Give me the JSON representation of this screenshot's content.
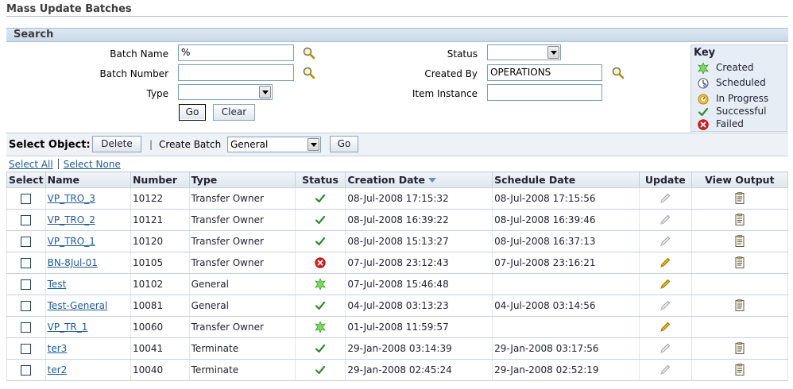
{
  "page": {
    "title": "Mass Update Batches"
  },
  "search": {
    "header": "Search",
    "batch_name_label": "Batch Name",
    "batch_name_value": "%",
    "batch_number_label": "Batch Number",
    "batch_number_value": "",
    "type_label": "Type",
    "type_value": "",
    "status_label": "Status",
    "status_value": "",
    "created_by_label": "Created By",
    "created_by_value": "OPERATIONS",
    "item_instance_label": "Item Instance",
    "item_instance_value": "",
    "go_label": "Go",
    "clear_label": "Clear"
  },
  "key": {
    "title": "Key",
    "items": [
      {
        "icon": "created-icon",
        "label": "Created"
      },
      {
        "icon": "scheduled-icon",
        "label": "Scheduled"
      },
      {
        "icon": "in-progress-icon",
        "label": "In Progress"
      },
      {
        "icon": "successful-icon",
        "label": "Successful"
      },
      {
        "icon": "failed-icon",
        "label": "Failed"
      }
    ]
  },
  "toolbar": {
    "select_object_label": "Select Object:",
    "delete_label": "Delete",
    "pipe": "|",
    "create_batch_label": "Create Batch",
    "create_batch_value": "General",
    "go_label": "Go"
  },
  "selection": {
    "select_all": "Select All",
    "select_none": "Select None"
  },
  "table": {
    "headers": {
      "select": "Select",
      "name": "Name",
      "number": "Number",
      "type": "Type",
      "status": "Status",
      "creation_date": "Creation Date",
      "schedule_date": "Schedule Date",
      "update": "Update",
      "view_output": "View Output"
    },
    "rows": [
      {
        "name": "VP_TRO_3",
        "number": "10122",
        "type": "Transfer Owner",
        "status": "successful",
        "creation_date": "08-Jul-2008 17:15:32",
        "schedule_date": "08-Jul-2008 17:15:56",
        "update": "disabled",
        "view_output": true
      },
      {
        "name": "VP_TRO_2",
        "number": "10121",
        "type": "Transfer Owner",
        "status": "successful",
        "creation_date": "08-Jul-2008 16:39:22",
        "schedule_date": "08-Jul-2008 16:39:46",
        "update": "disabled",
        "view_output": true
      },
      {
        "name": "VP_TRO_1",
        "number": "10120",
        "type": "Transfer Owner",
        "status": "successful",
        "creation_date": "08-Jul-2008 15:13:27",
        "schedule_date": "08-Jul-2008 16:37:13",
        "update": "disabled",
        "view_output": true
      },
      {
        "name": "BN-8Jul-01",
        "number": "10105",
        "type": "Transfer Owner",
        "status": "failed",
        "creation_date": "07-Jul-2008 23:12:43",
        "schedule_date": "07-Jul-2008 23:16:21",
        "update": "enabled",
        "view_output": true
      },
      {
        "name": "Test",
        "number": "10102",
        "type": "General",
        "status": "created",
        "creation_date": "07-Jul-2008 15:46:48",
        "schedule_date": "",
        "update": "enabled",
        "view_output": false
      },
      {
        "name": "Test-General",
        "number": "10081",
        "type": "General",
        "status": "successful",
        "creation_date": "04-Jul-2008 03:13:23",
        "schedule_date": "04-Jul-2008 03:14:56",
        "update": "disabled",
        "view_output": true
      },
      {
        "name": "VP_TR_1",
        "number": "10060",
        "type": "Transfer Owner",
        "status": "created",
        "creation_date": "01-Jul-2008 11:59:57",
        "schedule_date": "",
        "update": "enabled",
        "view_output": false
      },
      {
        "name": "ter3",
        "number": "10041",
        "type": "Terminate",
        "status": "successful",
        "creation_date": "29-Jan-2008 03:14:39",
        "schedule_date": "29-Jan-2008 03:17:56",
        "update": "disabled",
        "view_output": true
      },
      {
        "name": "ter2",
        "number": "10040",
        "type": "Terminate",
        "status": "successful",
        "creation_date": "29-Jan-2008 02:45:24",
        "schedule_date": "29-Jan-2008 02:52:19",
        "update": "disabled",
        "view_output": true
      }
    ]
  },
  "colors": {
    "link": "#1e5a96",
    "success": "#2e8b2e",
    "failed": "#d42020",
    "created": "#55c455",
    "pencil_enabled": "#e8b800",
    "header_band": "#c9d8e8"
  }
}
